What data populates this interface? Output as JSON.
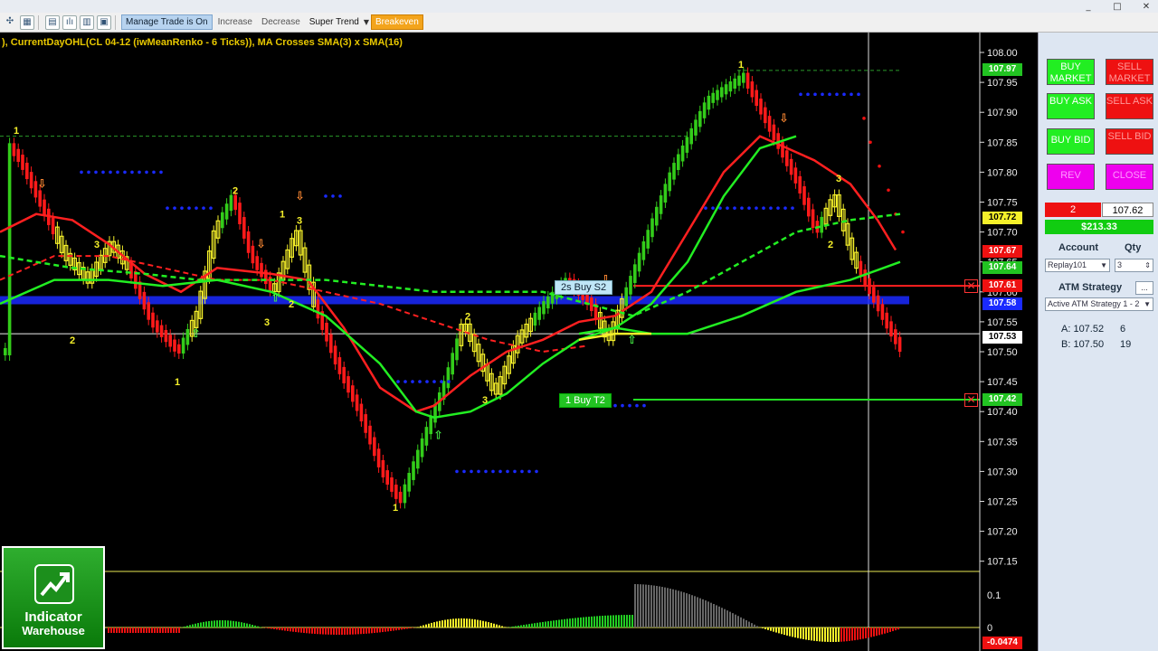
{
  "window": {
    "minimize": "_",
    "restore": "□",
    "close": "✕"
  },
  "toolbar": {
    "manage_trade": "Manage Trade is On",
    "increase": "Increase",
    "decrease": "Decrease",
    "super_trend": "Super Trend",
    "breakeven": "Breakeven"
  },
  "chart": {
    "title": "), CurrentDayOHL(CL 04-12 (iwMeanRenko - 6 Ticks)), MA Crosses SMA(3) x SMA(16)",
    "price_labels": [
      "108.00",
      "107.95",
      "107.90",
      "107.85",
      "107.80",
      "107.75",
      "107.70",
      "107.65",
      "107.60",
      "107.55",
      "107.50",
      "107.45",
      "107.40",
      "107.35",
      "107.30",
      "107.25",
      "107.20",
      "107.15"
    ],
    "osc_labels": [
      "0.1",
      "0"
    ],
    "tags": {
      "high": "107.97",
      "t1": "107.72",
      "stop": "107.67",
      "green": "107.64",
      "entry": "107.61",
      "blue": "107.58",
      "cursor": "107.53",
      "target": "107.42",
      "osc": "-0.0474"
    },
    "orders": {
      "stop": "2s  Buy S2",
      "target": "1  Buy T2"
    },
    "colors": {
      "bull": "#33cc1a",
      "bear": "#ff1a1a",
      "neutral": "#f5f02a",
      "dots": "#1a2aff"
    }
  },
  "panel": {
    "buy_market": "BUY MARKET",
    "sell_market": "SELL MARKET",
    "buy_ask": "BUY ASK",
    "sell_ask": "SELL ASK",
    "buy_bid": "BUY BID",
    "sell_bid": "SELL BID",
    "rev": "REV",
    "close": "CLOSE",
    "position_qty": "2",
    "position_price": "107.62",
    "pnl": "$213.33",
    "account_label": "Account",
    "qty_label": "Qty",
    "account_value": "Replay101",
    "qty_value": "3",
    "atm_label": "ATM Strategy",
    "atm_btn": "...",
    "atm_value": "Active ATM Strategy 1 - 2",
    "ask_label": "A: 107.52",
    "ask_size": "6",
    "bid_label": "B: 107.50",
    "bid_size": "19"
  },
  "logo": {
    "line1": "Indicator",
    "line2": "Warehouse"
  }
}
